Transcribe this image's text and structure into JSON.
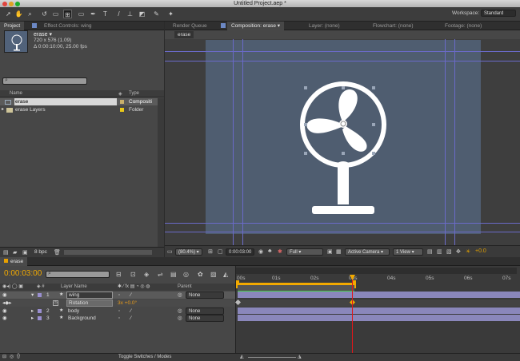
{
  "window": {
    "title": "Untitled Project.aep *"
  },
  "workspace": {
    "label": "Workspace:",
    "value": "Standard"
  },
  "project": {
    "tab": "Project",
    "effects_tab": "Effect Controls: wing",
    "item_name": "erase ▾",
    "info_line1": "720 x 576 (1.09)",
    "info_line2": "Δ 0:00:10:00, 25.00 fps",
    "col_name": "Name",
    "col_type": "Type",
    "bpc": "8 bpc",
    "items": [
      {
        "name": "erase",
        "type": "Compositi"
      },
      {
        "name": "erase Layers",
        "type": "Folder"
      }
    ]
  },
  "viewer": {
    "tabs": [
      "Render Queue",
      "Composition: erase ▾",
      "Layer: (none)",
      "Flowchart: (none)",
      "Footage: (none)"
    ],
    "comp_tab": "erase",
    "zoom": "(80.4%)",
    "timecode": "0:00:03:00",
    "resolution": "Full",
    "camera": "Active Camera",
    "views": "1 View",
    "exposure": "+0.0"
  },
  "timeline": {
    "tab": "erase",
    "timecode": "0:00:03:00",
    "col_layer": "Layer Name",
    "col_parent": "Parent",
    "ruler": [
      "00s",
      "01s",
      "02s",
      "03s",
      "04s",
      "05s",
      "06s",
      "07s"
    ],
    "layers": [
      {
        "num": "1",
        "name": "wing",
        "parent": "None"
      },
      {
        "num": "2",
        "name": "body",
        "parent": "None"
      },
      {
        "num": "3",
        "name": "Background",
        "parent": "None"
      }
    ],
    "property": {
      "name": "Rotation",
      "value": "3x +0.0°"
    },
    "toggle": "Toggle Switches / Modes"
  },
  "colors": {
    "accent": "#f2a900",
    "playhead": "#e0161a",
    "layer_bar": "#8a87bb"
  }
}
